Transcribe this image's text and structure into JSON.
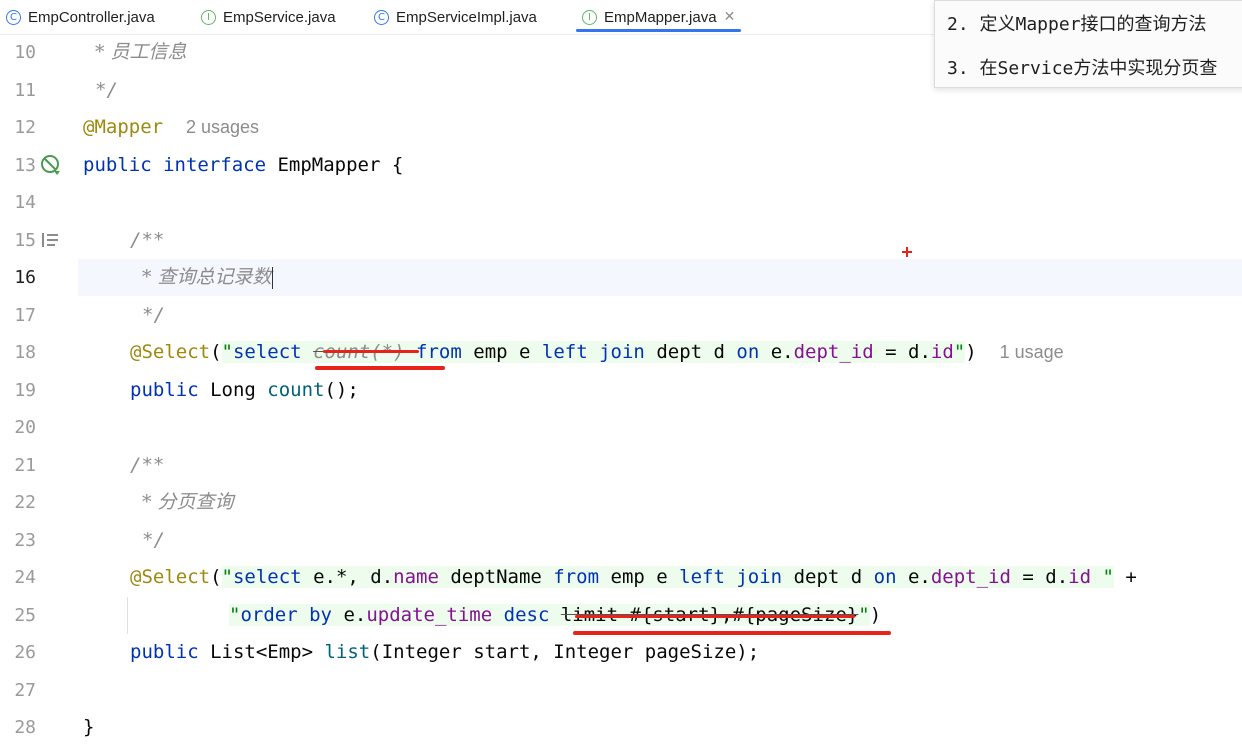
{
  "tabs": [
    {
      "label": "EmpController.java",
      "icon": "class-icon",
      "icon_glyph": "C"
    },
    {
      "label": "EmpService.java",
      "icon": "interface-icon",
      "icon_glyph": "I"
    },
    {
      "label": "EmpServiceImpl.java",
      "icon": "class-icon",
      "icon_glyph": "C"
    },
    {
      "label": "EmpMapper.java",
      "icon": "interface-icon",
      "icon_glyph": "I",
      "active": true
    }
  ],
  "popup": {
    "lines": [
      "2. 定义Mapper接口的查询方法",
      "3. 在Service方法中实现分页查"
    ]
  },
  "line_numbers": [
    "10",
    "11",
    "12",
    "13",
    "14",
    "15",
    "16",
    "17",
    "18",
    "19",
    "20",
    "21",
    "22",
    "23",
    "24",
    "25",
    "26",
    "27",
    "28"
  ],
  "code": {
    "l10": "* 员工信息",
    "l11": "*/",
    "l12_ann": "@Mapper",
    "l12_usage": "2 usages",
    "l13_kw1": "public",
    "l13_kw2": "interface",
    "l13_rest": " EmpMapper {",
    "l15": "/**",
    "l16": "* 查询总记录数",
    "l17": "*/",
    "l18_ann": "@Select",
    "l18_p": "(",
    "l18_q1": "\"",
    "l18_select": "select",
    "l18_count": "count(*)",
    "l18_from": "from",
    "l18_emp": " emp e ",
    "l18_left": "left",
    "l18_join": "join",
    "l18_dept": " dept d ",
    "l18_on": "on",
    "l18_e": " e.",
    "l18_deptid": "dept_id",
    "l18_eq": " = d.",
    "l18_id": "id",
    "l18_q2": "\"",
    "l18_pc": ")",
    "l18_usage": "1 usage",
    "l19_kw": "public",
    "l19_rest": " Long ",
    "l19_name": "count",
    "l19_end": "();",
    "l21": "/**",
    "l22": "* 分页查询",
    "l23": "*/",
    "l24_ann": "@Select",
    "l24_p": "(",
    "l24_q1": "\"",
    "l24_select": "select",
    "l24_a": " e.*, d.",
    "l24_name": "name",
    "l24_b": " deptName ",
    "l24_from": "from",
    "l24_c": " emp e ",
    "l24_left": "left",
    "l24_join": "join",
    "l24_d": " dept d ",
    "l24_on": "on",
    "l24_e": " e.",
    "l24_deptid": "dept_id",
    "l24_f": " = d.",
    "l24_id": "id",
    "l24_g": " ",
    "l24_q2": "\"",
    "l24_plus": " +",
    "l25_q1": "\"",
    "l25_order": "order",
    "l25_by": "by",
    "l25_a": " e.",
    "l25_ut": "update_time",
    "l25_desc": "desc",
    "l25_limit": "limit #{start},#{pageSize}",
    "l25_q2": "\"",
    "l25_pc": ")",
    "l26_kw": "public",
    "l26_a": " List<Emp> ",
    "l26_name": "list",
    "l26_b": "(Integer start, Integer pageSize);",
    "l28": "}"
  },
  "colors": {
    "keyword": "#0033b3",
    "annotation": "#9e880d",
    "comment": "#8c8c8c",
    "string": "#067d17",
    "field": "#871094",
    "red_underline": "#e8231c",
    "tab_accent": "#3574f0"
  }
}
